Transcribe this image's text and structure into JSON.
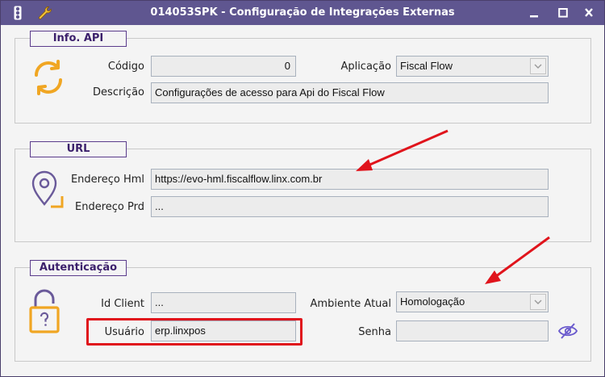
{
  "window": {
    "title": "014053SPK - Configuração de Integrações Externas"
  },
  "sections": {
    "info_api": {
      "legend": "Info. API",
      "codigo_label": "Código",
      "codigo_value": "0",
      "aplicacao_label": "Aplicação",
      "aplicacao_value": "Fiscal Flow",
      "descricao_label": "Descrição",
      "descricao_value": "Configurações de acesso para Api do Fiscal Flow"
    },
    "url": {
      "legend": "URL",
      "hml_label": "Endereço Hml",
      "hml_value": "https://evo-hml.fiscalflow.linx.com.br",
      "prd_label": "Endereço Prd",
      "prd_value": "..."
    },
    "auth": {
      "legend": "Autenticação",
      "idclient_label": "Id Client",
      "idclient_value": "...",
      "usuario_label": "Usuário",
      "usuario_value": "erp.linxpos",
      "ambiente_label": "Ambiente Atual",
      "ambiente_value": "Homologação",
      "senha_label": "Senha",
      "senha_value": ""
    }
  },
  "colors": {
    "titlebar": "#5f5690",
    "accent_orange": "#f0a623",
    "legend_border": "#5b3c8c",
    "annotation_red": "#e0141c"
  },
  "icons": {
    "app_menu": "traffic-light-icon",
    "tools": "wrench-icon",
    "refresh": "refresh-icon",
    "location": "location-pin-icon",
    "lock": "padlock-icon",
    "password_toggle": "eye-slash-icon"
  }
}
